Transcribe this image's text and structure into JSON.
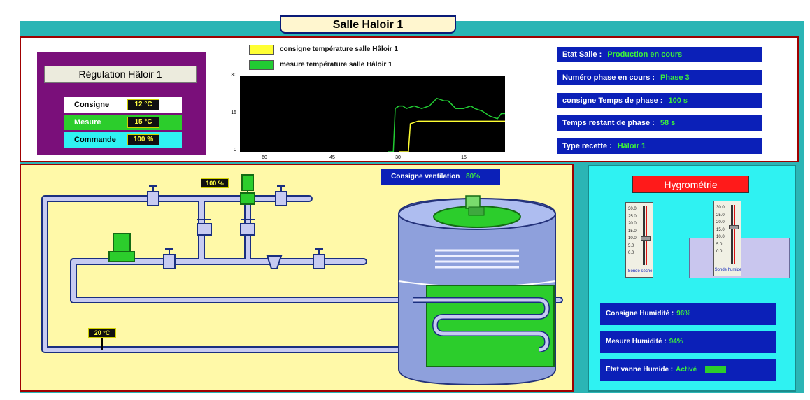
{
  "window": {
    "title": "Salle Haloir 1"
  },
  "regulation": {
    "title": "Régulation Hâloir 1",
    "rows": [
      {
        "label": "Consigne",
        "value": "12 °C",
        "color": "#ffffff"
      },
      {
        "label": "Mesure",
        "value": "15 °C",
        "color": "#2ccd2c"
      },
      {
        "label": "Commande",
        "value": "100 %",
        "color": "#2ff2f2"
      }
    ]
  },
  "trend": {
    "legend": [
      {
        "label": "consigne température salle Hâloir 1",
        "color": "#ffff33"
      },
      {
        "label": "mesure température salle Hâloir 1",
        "color": "#22cc33"
      }
    ],
    "y_ticks": [
      "30",
      "15",
      "0"
    ],
    "x_ticks": [
      "60",
      "45",
      "30",
      "15"
    ]
  },
  "status": [
    {
      "label": "Etat Salle :",
      "value": "Production en cours"
    },
    {
      "label": "Numéro phase en cours :",
      "value": "Phase 3"
    },
    {
      "label": "consigne Temps de phase :",
      "value": "100 s"
    },
    {
      "label": "Temps restant de phase :",
      "value": "58 s"
    },
    {
      "label": "Type recette :",
      "value": "Hâloir 1"
    }
  ],
  "process": {
    "valve_opening": "100 %",
    "water_temperature": "20 °C",
    "ventilation": {
      "label": "Consigne ventilation",
      "value": "80%"
    }
  },
  "hygrometry": {
    "title": "Hygrométrie",
    "gauges": [
      {
        "ticks": [
          "30.0",
          "25.0",
          "20.0",
          "15.0",
          "10.0",
          "5.0",
          "0.0"
        ],
        "label": "Sonde sèche"
      },
      {
        "ticks": [
          "30.0",
          "25.0",
          "20.0",
          "15.0",
          "10.0",
          "5.0",
          "0.0"
        ],
        "label": "Sonde humide"
      }
    ],
    "consigne": {
      "label": "Consigne Humidité :",
      "value": "96%"
    },
    "mesure": {
      "label": "Mesure Humidité :",
      "value": "94%"
    },
    "vanne": {
      "label": "Etat vanne Humide :",
      "value": "Activé"
    }
  },
  "chart_data": {
    "type": "line",
    "x_reversed": true,
    "xlim": [
      70,
      0
    ],
    "ylim": [
      0,
      30
    ],
    "series": [
      {
        "name": "consigne température salle Hâloir 1",
        "color": "#ffff33",
        "x": [
          28,
          25.5,
          25,
          23,
          19,
          15,
          10,
          5,
          0
        ],
        "y": [
          0,
          0,
          11,
          12,
          12,
          12,
          12,
          12,
          12
        ]
      },
      {
        "name": "mesure température salle Hâloir 1",
        "color": "#22cc33",
        "x": [
          31,
          29.5,
          29,
          28,
          27,
          26,
          24,
          22,
          20,
          18,
          16,
          15,
          13,
          11,
          9,
          8,
          6,
          4,
          2,
          1,
          0
        ],
        "y": [
          0,
          0,
          17,
          18,
          18,
          17,
          18,
          17,
          18,
          21,
          20,
          20,
          17,
          17,
          18,
          17,
          16,
          14,
          13,
          15,
          15
        ]
      }
    ]
  }
}
